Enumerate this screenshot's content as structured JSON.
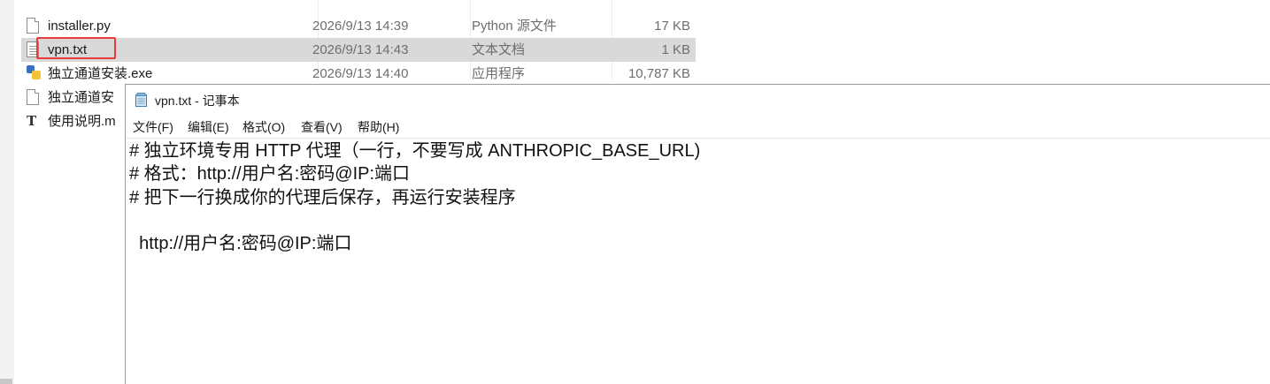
{
  "explorer": {
    "files": [
      {
        "name": "installer.py",
        "date": "2026/9/13 14:39",
        "type": "Python 源文件",
        "size": "17 KB",
        "icon": "python-file-icon"
      },
      {
        "name": "vpn.txt",
        "date": "2026/9/13 14:43",
        "type": "文本文档",
        "size": "1 KB",
        "icon": "text-file-icon"
      },
      {
        "name": "独立通道安装.exe",
        "date": "2026/9/13 14:40",
        "type": "应用程序",
        "size": "10,787 KB",
        "icon": "exe-file-icon"
      },
      {
        "name": "独立通道安",
        "date": "",
        "type": "",
        "size": "",
        "icon": "document-file-icon"
      },
      {
        "name": "使用说明.m",
        "date": "",
        "type": "",
        "size": "",
        "icon": "markdown-file-icon"
      }
    ],
    "selected_index": 1,
    "highlight_color": "#e83b3b"
  },
  "notepad": {
    "title": "vpn.txt - 记事本",
    "menu": [
      "文件(F)",
      "编辑(E)",
      "格式(O)",
      "查看(V)",
      "帮助(H)"
    ],
    "lines": [
      "# 独立环境专用 HTTP 代理（一行，不要写成 ANTHROPIC_BASE_URL)",
      "# 格式：http://用户名:密码@IP:端口",
      "# 把下一行换成你的代理后保存，再运行安装程序",
      "",
      "  http://用户名:密码@IP:端口"
    ]
  }
}
